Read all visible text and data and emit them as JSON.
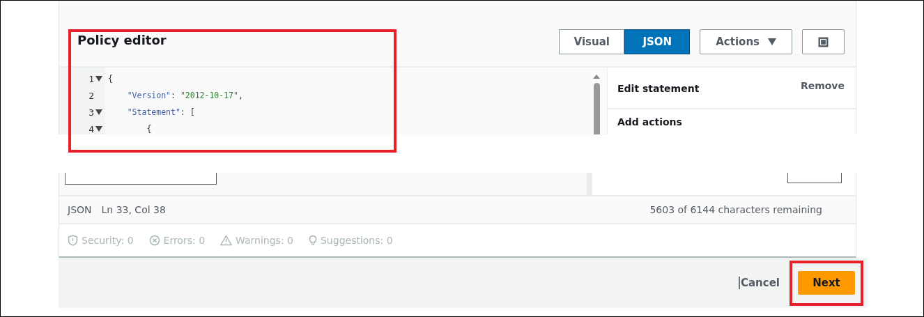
{
  "editor": {
    "title": "Policy editor",
    "mode_tabs": [
      {
        "label": "Visual",
        "selected": false
      },
      {
        "label": "JSON",
        "selected": true
      }
    ],
    "actions_button": "Actions",
    "code_lines": [
      {
        "number": "1",
        "foldable": true,
        "tokens": [
          {
            "kind": "punct",
            "text": "{"
          }
        ]
      },
      {
        "number": "2",
        "foldable": false,
        "tokens": [
          {
            "kind": "key",
            "text": "    \"Version\""
          },
          {
            "kind": "punct",
            "text": ": "
          },
          {
            "kind": "string",
            "text": "\"2012-10-17\""
          },
          {
            "kind": "punct",
            "text": ","
          }
        ]
      },
      {
        "number": "3",
        "foldable": true,
        "tokens": [
          {
            "kind": "key",
            "text": "    \"Statement\""
          },
          {
            "kind": "punct",
            "text": ": ["
          }
        ]
      },
      {
        "number": "4",
        "foldable": true,
        "tokens": [
          {
            "kind": "punct",
            "text": "        {"
          }
        ]
      }
    ],
    "side_panel": {
      "heading": "Edit statement",
      "remove": "Remove",
      "section": "Add actions"
    },
    "status": {
      "language": "JSON",
      "position": "Ln 33, Col 38",
      "remaining": "5603 of 6144 characters remaining"
    },
    "checks": [
      {
        "kind": "security",
        "label": "Security: 0"
      },
      {
        "kind": "errors",
        "label": "Errors: 0"
      },
      {
        "kind": "warnings",
        "label": "Warnings: 0"
      },
      {
        "kind": "suggestions",
        "label": "Suggestions: 0"
      }
    ]
  },
  "footer": {
    "cancel": "Cancel",
    "next": "Next"
  }
}
